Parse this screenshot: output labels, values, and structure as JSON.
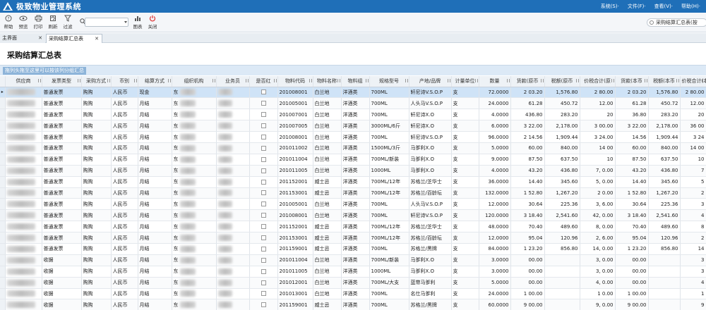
{
  "app": {
    "title": "极致物业管理系统"
  },
  "menus": [
    "系统(S)·",
    "文件(F)·",
    "查看(V)·",
    "帮助(H)·"
  ],
  "toolbar": [
    {
      "label": "帮助",
      "icon": "help-icon"
    },
    {
      "label": "预览",
      "icon": "eye-icon"
    },
    {
      "label": "打印",
      "icon": "printer-icon"
    },
    {
      "label": "刷新",
      "icon": "refresh-icon"
    },
    {
      "label": "过滤",
      "icon": "filter-icon"
    },
    {
      "label": "图表",
      "icon": "chart-icon"
    },
    {
      "label": "关闭",
      "icon": "power-icon"
    }
  ],
  "right_search": {
    "text": "采购结算汇总表(按"
  },
  "tabs": [
    {
      "label": "主界面",
      "close": "✕"
    },
    {
      "label": "采购结算汇总表",
      "close": "✕"
    }
  ],
  "page": {
    "title": "采购结算汇总表",
    "group_hint": "拖列头拖至这里可以按该列分组汇总"
  },
  "colors": {
    "titlebar": "#1f6fb8",
    "selected_row": "#cfe3f7",
    "group_hint": "#8db4d9"
  },
  "columns": [
    "供应商",
    "发票类型",
    "采购方式",
    "币别",
    "结算方式",
    "组织机构",
    "业务员",
    "是否红",
    "物料代码",
    "物料名称",
    "物料组",
    "规格型号",
    "产地/品牌",
    "计量单位",
    "数量",
    "货款(原币",
    "税额(原币",
    "价税合计(原",
    "货款(本币",
    "税额(本币",
    "价税合计(本"
  ],
  "rows": [
    [
      "",
      "普通发票",
      "购购",
      "人民币",
      "现金",
      "东",
      "",
      "",
      "201008001",
      "白兰地",
      "洋酒类",
      "700ML",
      "轩尼诗V.S.O.P",
      "支",
      "72.0000",
      "2 03.20",
      "1,576.80",
      "2 80.00",
      "2 03.20",
      "1,576.80",
      "2 80.00"
    ],
    [
      "",
      "普通发票",
      "购购",
      "人民币",
      "月结",
      "东",
      "",
      "",
      "201005001",
      "白兰地",
      "洋酒类",
      "700ML",
      "人头马V.S.O.P",
      "支",
      "24.0000",
      "61.28",
      "450.72",
      "12.00",
      "61.28",
      "450.72",
      "12.00"
    ],
    [
      "",
      "普通发票",
      "购购",
      "人民币",
      "月结",
      "东",
      "",
      "",
      "201007001",
      "白兰地",
      "洋酒类",
      "700ML",
      "轩尼诗X.O",
      "支",
      "4.0000",
      "436.80",
      "283.20",
      "20",
      "36.80",
      "283.20",
      "20"
    ],
    [
      "",
      "普通发票",
      "购购",
      "人民币",
      "月结",
      "东",
      "",
      "",
      "201007005",
      "白兰地",
      "洋酒类",
      "3000ML/6斤",
      "轩尼诗X.O",
      "支",
      "6.0000",
      "3 22.00",
      "2,178.00",
      "3 00.00",
      "3 22.00",
      "2,178.00",
      "36 00"
    ],
    [
      "",
      "普通发票",
      "购购",
      "人民币",
      "月结",
      "东",
      "",
      "",
      "201008001",
      "白兰地",
      "洋酒类",
      "700ML",
      "轩尼诗V.S.O.P",
      "支",
      "96.0000",
      "2 14.56",
      "1,909.44",
      "3 24.00",
      "14.56",
      "1,909.44",
      "3 24"
    ],
    [
      "",
      "普通发票",
      "购购",
      "人民币",
      "月结",
      "东",
      "",
      "",
      "201011002",
      "白兰地",
      "洋酒类",
      "1500ML/3斤",
      "马爹利X.O",
      "支",
      "5.0000",
      "60.00",
      "840.00",
      "14 00",
      "60.00",
      "840.00",
      "14 00"
    ],
    [
      "",
      "普通发票",
      "购购",
      "人民币",
      "月结",
      "东",
      "",
      "",
      "201011004",
      "白兰地",
      "洋酒类",
      "700ML/新装",
      "马爹利X.O",
      "支",
      "9.0000",
      "87.50",
      "637.50",
      "10",
      "87.50",
      "637.50",
      "10"
    ],
    [
      "",
      "普通发票",
      "购购",
      "人民币",
      "月结",
      "东",
      "",
      "",
      "201011005",
      "白兰地",
      "洋酒类",
      "1000ML",
      "马爹利X.O",
      "支",
      "4.0000",
      "43.20",
      "436.80",
      "7, 0.00",
      "43.20",
      "436.80",
      "7"
    ],
    [
      "",
      "普通发票",
      "购购",
      "人民币",
      "月结",
      "东",
      "",
      "",
      "201152001",
      "威士忌",
      "洋酒类",
      "700ML/12年",
      "苏格兰/芝华士",
      "支",
      "36.0000",
      "14.40",
      "345.60",
      "5, 0.00",
      "14.40",
      "345.60",
      "5"
    ],
    [
      "",
      "普通发票",
      "购购",
      "人民币",
      "月结",
      "东",
      "",
      "",
      "201153001",
      "威士忌",
      "洋酒类",
      "700ML/12年",
      "苏格兰/百龄坛",
      "支",
      "132.0000",
      "1 52.80",
      "1,267.20",
      "2 0.00",
      "1 52.80",
      "1,267.20",
      "2"
    ],
    [
      "",
      "普通发票",
      "购购",
      "人民币",
      "月结",
      "东",
      "",
      "",
      "201005001",
      "白兰地",
      "洋酒类",
      "700ML",
      "人头马V.S.O.P",
      "支",
      "12.0000",
      "30.64",
      "225.36",
      "3, 6.00",
      "30.64",
      "225.36",
      "3"
    ],
    [
      "",
      "普通发票",
      "购购",
      "人民币",
      "月结",
      "东",
      "",
      "",
      "201008001",
      "白兰地",
      "洋酒类",
      "700ML",
      "轩尼诗V.S.O.P",
      "支",
      "120.0000",
      "3 18.40",
      "2,541.60",
      "42, 0.00",
      "3 18.40",
      "2,541.60",
      "4"
    ],
    [
      "",
      "普通发票",
      "购购",
      "人民币",
      "月结",
      "东",
      "",
      "",
      "201152001",
      "威士忌",
      "洋酒类",
      "700ML/12年",
      "苏格兰/芝华士",
      "支",
      "48.0000",
      "70.40",
      "489.60",
      "8, 0.00",
      "70.40",
      "489.60",
      "8"
    ],
    [
      "",
      "普通发票",
      "购购",
      "人民币",
      "月结",
      "东",
      "",
      "",
      "201153001",
      "威士忌",
      "洋酒类",
      "700ML/12年",
      "苏格兰/百龄坛",
      "支",
      "12.0000",
      "95.04",
      "120.96",
      "2, 6.00",
      "95.04",
      "120.96",
      "2"
    ],
    [
      "",
      "普通发票",
      "购购",
      "人民币",
      "月结",
      "东",
      "",
      "",
      "201159001",
      "威士忌",
      "洋酒类",
      "700ML",
      "苏格兰/黑牌",
      "支",
      "84.0000",
      "1 23.20",
      "856.80",
      "14, 0.00",
      "1 23.20",
      "856.80",
      "14"
    ],
    [
      "",
      "收据",
      "购购",
      "人民币",
      "月结",
      "东",
      "",
      "",
      "201011004",
      "白兰地",
      "洋酒类",
      "700ML/新装",
      "马爹利X.O",
      "支",
      "3.0000",
      "00.00",
      "",
      "3, 0.00",
      "00.00",
      "",
      "3"
    ],
    [
      "",
      "收据",
      "购购",
      "人民币",
      "月结",
      "东",
      "",
      "",
      "201011005",
      "白兰地",
      "洋酒类",
      "1000ML",
      "马爹利X.O",
      "支",
      "3.0000",
      "00.00",
      "",
      "3, 0.00",
      "00.00",
      "",
      "3"
    ],
    [
      "",
      "收据",
      "购购",
      "人民币",
      "月结",
      "东",
      "",
      "",
      "201012001",
      "白兰地",
      "洋酒类",
      "700ML/大支",
      "蓝带马爹利",
      "支",
      "5.0000",
      "00.00",
      "",
      "4, 0.00",
      "00.00",
      "",
      "4"
    ],
    [
      "",
      "收据",
      "购购",
      "人民币",
      "月结",
      "东",
      "",
      "",
      "201013001",
      "白兰地",
      "洋酒类",
      "700ML",
      "名仕马爹利",
      "支",
      "24.0000",
      "1 00.00",
      "",
      "1 0.00",
      "1 00.00",
      "",
      "1"
    ],
    [
      "",
      "收据",
      "购购",
      "人民币",
      "月结",
      "东",
      "",
      "",
      "201159001",
      "威士忌",
      "洋酒类",
      "700ML",
      "苏格兰/黑牌",
      "支",
      "60.0000",
      "9 00.00",
      "",
      "9, 0.00",
      "9 00.00",
      "",
      "9"
    ]
  ]
}
